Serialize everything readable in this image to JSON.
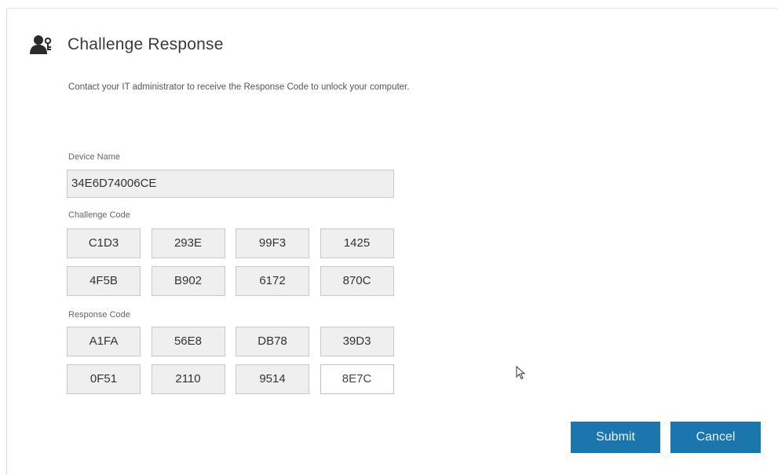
{
  "header": {
    "title": "Challenge Response",
    "icon": "user-key-icon"
  },
  "instructions": "Contact your IT administrator to receive the Response Code to unlock your computer.",
  "device": {
    "label": "Device Name",
    "value": "34E6D74006CE"
  },
  "challenge": {
    "label": "Challenge Code",
    "codes": [
      "C1D3",
      "293E",
      "99F3",
      "1425",
      "4F5B",
      "B902",
      "6172",
      "870C"
    ]
  },
  "response": {
    "label": "Response Code",
    "codes": [
      "A1FA",
      "56E8",
      "DB78",
      "39D3",
      "0F51",
      "2110",
      "9514",
      "8E7C"
    ]
  },
  "buttons": {
    "submit": "Submit",
    "cancel": "Cancel"
  },
  "colors": {
    "accent": "#1a76ad",
    "field_bg": "#efefef"
  }
}
